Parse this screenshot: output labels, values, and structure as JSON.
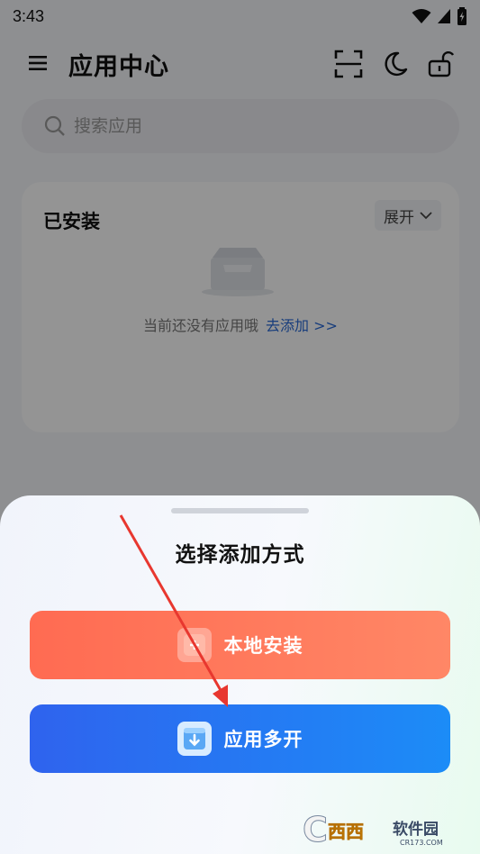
{
  "status_bar": {
    "time": "3:43"
  },
  "header": {
    "title": "应用中心",
    "icons": [
      "menu-icon",
      "scan-icon",
      "moon-icon",
      "unlock-icon"
    ]
  },
  "search": {
    "placeholder": "搜索应用"
  },
  "installed": {
    "title": "已安装",
    "expand_label": "展开",
    "empty_text": "当前还没有应用哦",
    "add_link": "去添加 >>"
  },
  "sheet": {
    "title": "选择添加方式",
    "local_install_label": "本地安装",
    "multi_open_label": "应用多开"
  },
  "watermark": {
    "text": "西西软件园",
    "subtext": "CR173.COM"
  },
  "colors": {
    "local_button": "#ff7258",
    "multi_button": "#2a74f2",
    "link": "#2a6ad6",
    "annotation_arrow": "#e8372f"
  }
}
